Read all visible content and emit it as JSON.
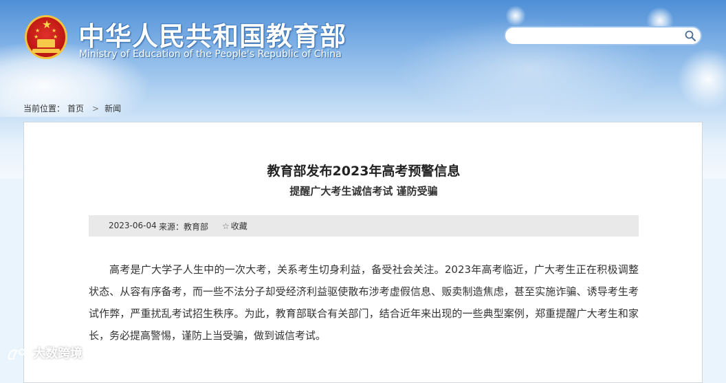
{
  "header": {
    "title_cn": "中华人民共和国教育部",
    "title_en": "Ministry of Education of the People's Republic of China",
    "emblem_icon": "national-emblem-icon"
  },
  "search": {
    "value": "",
    "placeholder": "",
    "icon": "search-icon"
  },
  "breadcrumb": {
    "label": "当前位置：",
    "items": [
      "首页",
      "新闻"
    ],
    "separator_icon": "chevron-right-icon"
  },
  "article": {
    "title": "教育部发布2023年高考预警信息",
    "subtitle": "提醒广大考生诚信考试 谨防受骗",
    "date": "2023-06-04",
    "source": "来源：教育部",
    "favorite_label": "收藏",
    "favorite_icon": "star-outline-icon",
    "body": "高考是广大学子人生中的一次大考，关系考生切身利益，备受社会关注。2023年高考临近，广大考生正在积极调整状态、从容有序备考，而一些不法分子却受经济利益驱使散布涉考虚假信息、贩卖制造焦虑，甚至实施诈骗、诱导考生考试作弊，严重扰乱考试招生秩序。为此，教育部联合有关部门，结合近年来出现的一些典型案例，郑重提醒广大考生和家长，务必提高警惕，谨防上当受骗，做到诚信考试。"
  },
  "watermark": {
    "text": "大数跨境"
  },
  "colors": {
    "sky_top": "#4f8fd6",
    "emblem_red": "#c11a14",
    "emblem_gold": "#f2c440",
    "meta_bar": "#e9e9e9",
    "search_border": "#9cc3ec"
  }
}
